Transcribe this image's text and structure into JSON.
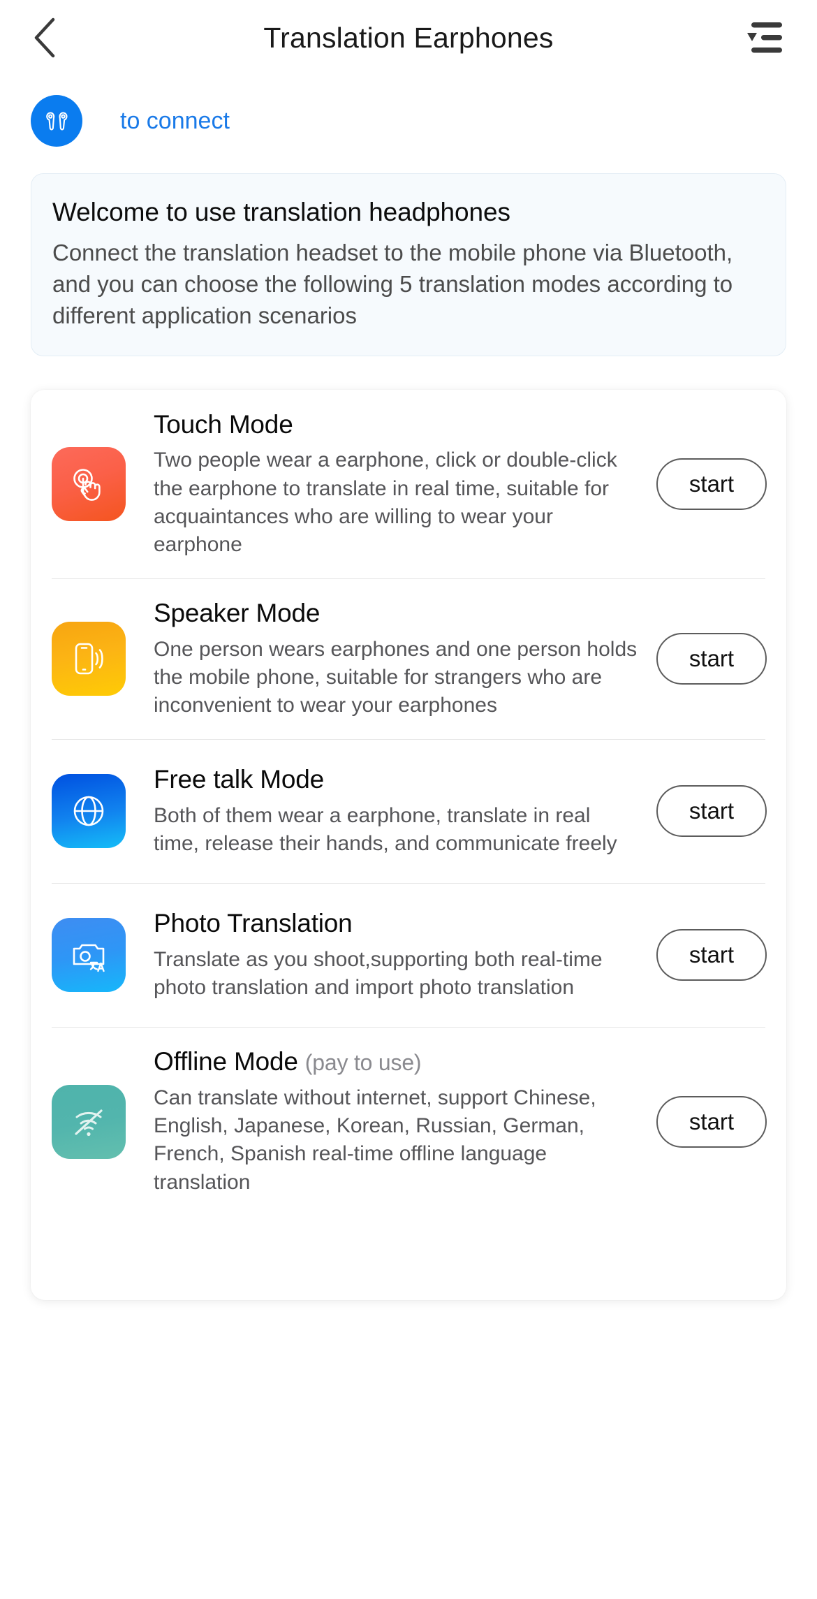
{
  "header": {
    "title": "Translation Earphones",
    "back_icon": "chevron-left-icon",
    "menu_icon": "list-menu-icon"
  },
  "connect": {
    "icon": "earbuds-icon",
    "label": "to connect",
    "label_color": "#1a7ae8",
    "badge_color": "#0a7cef"
  },
  "welcome": {
    "title": "Welcome to use translation headphones",
    "body": "Connect the translation headset to the mobile phone via Bluetooth, and you can choose the following 5 translation modes according to different application scenarios",
    "background": "#f6fafd",
    "border": "#e3edf5"
  },
  "modes": [
    {
      "title": "Touch Mode",
      "title_suffix": "",
      "description": "Two people wear a earphone, click or double-click the earphone to translate in real time, suitable for acquaintances who are willing to wear your earphone",
      "icon": "touch-gesture-icon",
      "icon_color": "#fb6048",
      "action_label": "start"
    },
    {
      "title": "Speaker Mode",
      "title_suffix": "",
      "description": "One person wears earphones and one person holds the mobile phone, suitable for strangers who are inconvenient to wear your earphones",
      "icon": "phone-speaker-icon",
      "icon_color": "#fcb414",
      "action_label": "start"
    },
    {
      "title": "Free talk Mode",
      "title_suffix": "",
      "description": "Both of them wear a earphone, translate in real time, release their hands, and communicate freely",
      "icon": "globe-icon",
      "icon_color": "#1183ef",
      "action_label": "start"
    },
    {
      "title": "Photo Translation",
      "title_suffix": "",
      "description": "Translate as you shoot,supporting both real-time photo translation and import photo translation",
      "icon": "camera-translate-icon",
      "icon_color": "#2e96f6",
      "action_label": "start"
    },
    {
      "title": "Offline Mode",
      "title_suffix": "(pay to use)",
      "description": "Can translate without internet, support Chinese, English, Japanese, Korean, Russian, German, French, Spanish real-time offline language translation",
      "icon": "wifi-off-icon",
      "icon_color": "#52b5ad",
      "action_label": "start"
    }
  ]
}
